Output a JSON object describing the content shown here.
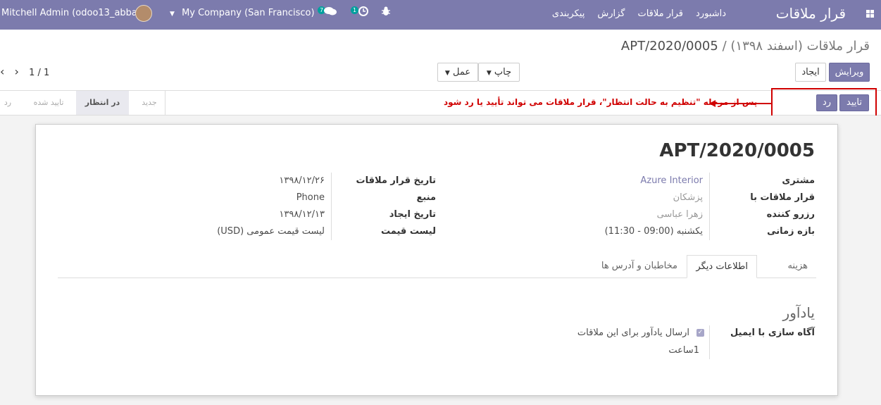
{
  "navbar": {
    "user": "Mitchell Admin (odoo13_abbasi)",
    "company": "My Company (San Francisco)",
    "chat_count": "7",
    "activity_count": "1",
    "menus": [
      "داشبورد",
      "قرار ملاقات",
      "گزارش",
      "پیکربندی"
    ],
    "app_title": "قرار ملاقات",
    "accent_color": "#7c7bad"
  },
  "breadcrumb": {
    "parent": "قرار ملاقات (اسفند ۱۳۹۸)",
    "separator": "/",
    "current": "APT/2020/0005"
  },
  "buttons": {
    "edit": "ویرایش",
    "create": "ایجاد",
    "print": "چاپ",
    "action": "عمل",
    "confirm": "تایید",
    "cancel": "رد"
  },
  "pager": {
    "value": "1 / 1"
  },
  "statusbar": {
    "stages": [
      "جدید",
      "در انتظار",
      "تایید شده",
      "رد"
    ],
    "active_stage": "در انتظار"
  },
  "annotation": "پس از مرحله \"تنظیم به حالت انتظار\"، قرار ملاقات می تواند تأیید یا رد شود",
  "record": {
    "name": "APT/2020/0005",
    "left_fields": [
      {
        "label": "مشتری",
        "value": "Azure Interior"
      },
      {
        "label": "قرار ملاقات با",
        "value": "پزشکان"
      },
      {
        "label": "رزرو کننده",
        "value": "زهرا عباسی"
      },
      {
        "label": "بازه زمانی",
        "value": "یکشنبه (09:00 - 11:30)"
      }
    ],
    "right_fields": [
      {
        "label": "تاریخ قرار ملاقات",
        "value": "۱۳۹۸/۱۲/۲۶"
      },
      {
        "label": "منبع",
        "value": "Phone"
      },
      {
        "label": "تاریخ ایجاد",
        "value": "۱۳۹۸/۱۲/۱۳"
      },
      {
        "label": "لیست قیمت",
        "value": "لیست قیمت عمومی (USD)"
      }
    ]
  },
  "tabs": [
    "هزینه",
    "اطلاعات دیگر",
    "مخاطبان و آدرس ها"
  ],
  "active_tab": "اطلاعات دیگر",
  "reminder": {
    "title": "یادآور",
    "label": "آگاه سازی با ایمیل",
    "checkbox_label": "ارسال یادآور برای این ملاقات",
    "checked": true,
    "time": "1ساعت"
  }
}
